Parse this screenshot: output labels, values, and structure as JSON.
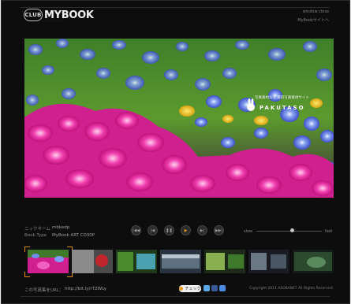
{
  "header": {
    "logo_club": "CLUB",
    "logo_mybook": "MYBOOK",
    "window_close": "window close",
    "mybook_site": "MyBookサイトへ"
  },
  "photo": {
    "watermark_tagline": "写真素材なら 無料写真素材サイト",
    "watermark_name": "PAKUTASO"
  },
  "meta": {
    "nickname_label": "ニックネーム",
    "nickname_value": "mbkedp",
    "book_type_label": "Book Type",
    "book_type_value": "MyBook ART CD30P"
  },
  "player": {
    "first_icon": "first-icon",
    "prev_icon": "prev-icon",
    "pause_icon": "pause-icon",
    "play_icon": "play-icon",
    "next_icon": "next-icon",
    "last_icon": "last-icon",
    "slow_label": "slow",
    "fast_label": "fast",
    "speed_level": 0.55,
    "accent_color": "#e59a1a"
  },
  "thumbnails": [
    {
      "name": "flowers",
      "selected": true
    },
    {
      "name": "gray-apple",
      "selected": false
    },
    {
      "name": "green-plants",
      "selected": false
    },
    {
      "name": "sky-clouds",
      "selected": false
    },
    {
      "name": "meadow",
      "selected": false
    },
    {
      "name": "building",
      "selected": false
    },
    {
      "name": "dark-green",
      "selected": false
    }
  ],
  "footer": {
    "share_label": "この写真集をURL：",
    "share_url": "http://bit.ly/rTZWLy",
    "check_label": "チェック",
    "copyright": "Copyright 2011 ASUKANET All Rights Reserved."
  }
}
